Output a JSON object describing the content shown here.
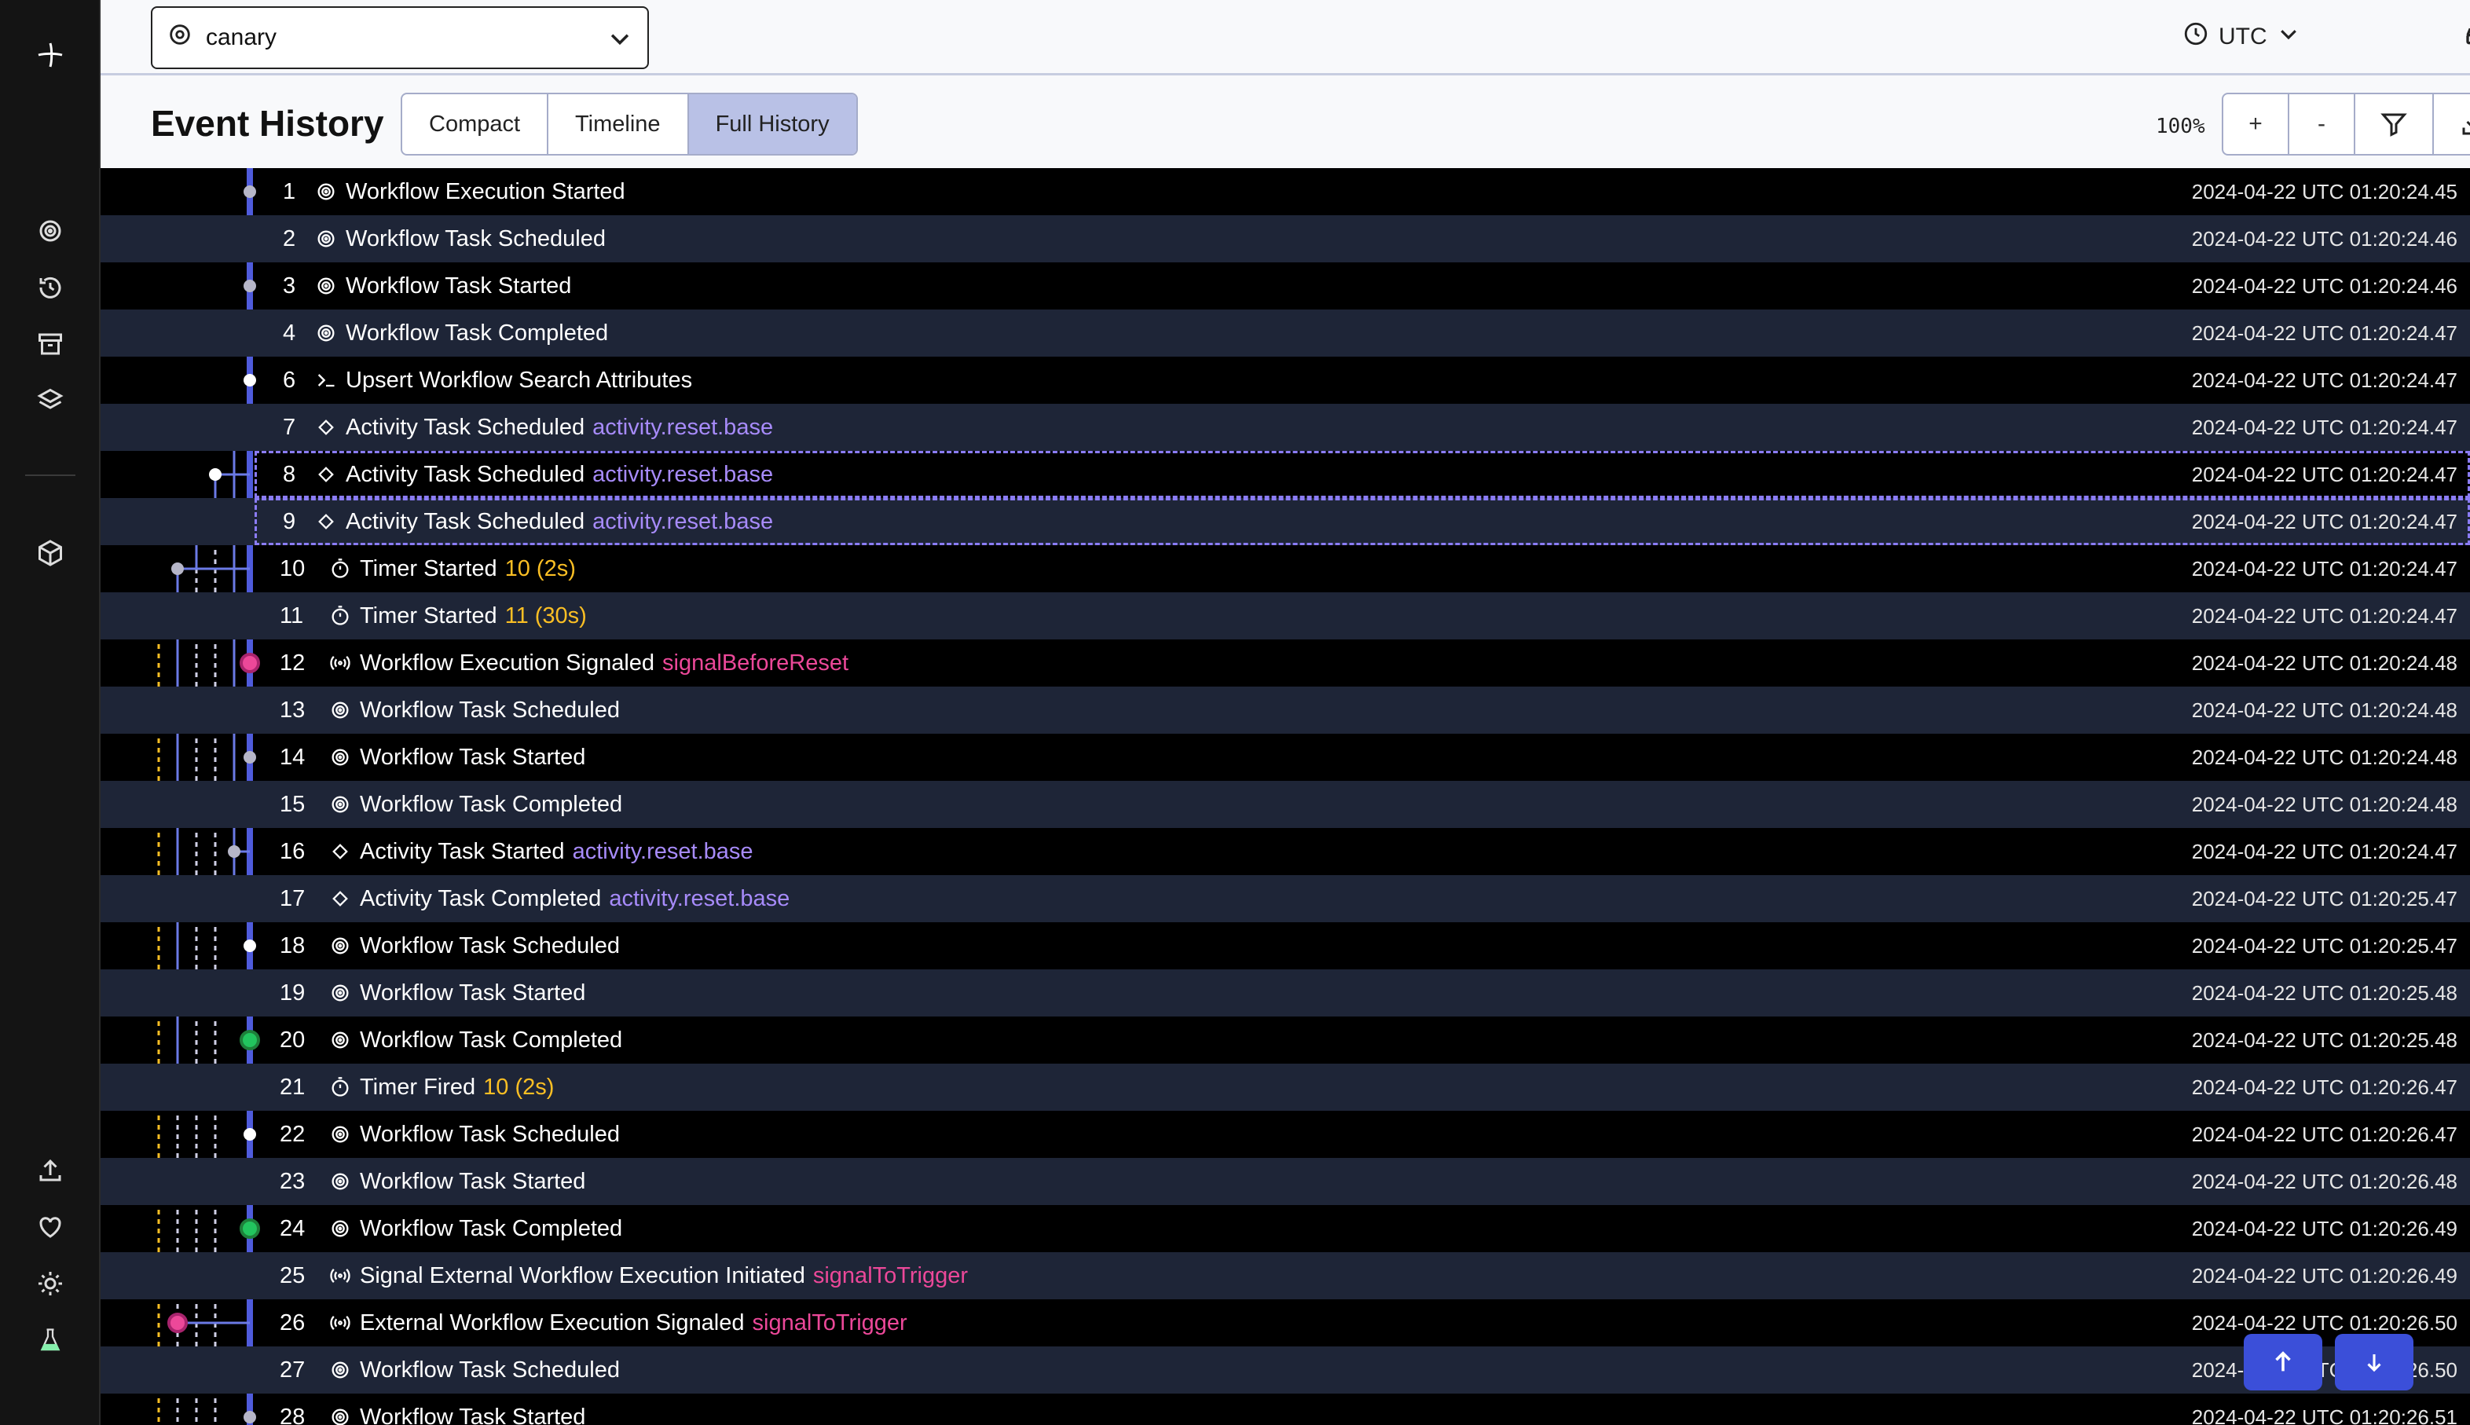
{
  "app": {
    "namespace": "canary",
    "timezone": "UTC"
  },
  "header": {
    "title": "Event History",
    "tabs": [
      {
        "label": "Compact"
      },
      {
        "label": "Timeline"
      },
      {
        "label": "Full History"
      }
    ],
    "zoom": "100%",
    "zoom_in": "+",
    "zoom_out": "-"
  },
  "events": [
    {
      "n": "1",
      "name": "Workflow Execution Started",
      "tag": "",
      "ts": "2024-04-22 UTC 01:20:24.45"
    },
    {
      "n": "2",
      "name": "Workflow Task Scheduled",
      "tag": "",
      "ts": "2024-04-22 UTC 01:20:24.46"
    },
    {
      "n": "3",
      "name": "Workflow Task Started",
      "tag": "",
      "ts": "2024-04-22 UTC 01:20:24.46"
    },
    {
      "n": "4",
      "name": "Workflow Task Completed",
      "tag": "",
      "ts": "2024-04-22 UTC 01:20:24.47"
    },
    {
      "n": "6",
      "name": "Upsert Workflow Search Attributes",
      "tag": "",
      "ts": "2024-04-22 UTC 01:20:24.47"
    },
    {
      "n": "7",
      "name": "Activity Task Scheduled",
      "tag": "activity.reset.base",
      "ts": "2024-04-22 UTC 01:20:24.47"
    },
    {
      "n": "8",
      "name": "Activity Task Scheduled",
      "tag": "activity.reset.base",
      "ts": "2024-04-22 UTC 01:20:24.47"
    },
    {
      "n": "9",
      "name": "Activity Task Scheduled",
      "tag": "activity.reset.base",
      "ts": "2024-04-22 UTC 01:20:24.47"
    },
    {
      "n": "10",
      "name": "Timer Started",
      "tag": "10 (2s)",
      "ts": "2024-04-22 UTC 01:20:24.47"
    },
    {
      "n": "11",
      "name": "Timer Started",
      "tag": "11 (30s)",
      "ts": "2024-04-22 UTC 01:20:24.47"
    },
    {
      "n": "12",
      "name": "Workflow Execution Signaled",
      "tag": "signalBeforeReset",
      "ts": "2024-04-22 UTC 01:20:24.48"
    },
    {
      "n": "13",
      "name": "Workflow Task Scheduled",
      "tag": "",
      "ts": "2024-04-22 UTC 01:20:24.48"
    },
    {
      "n": "14",
      "name": "Workflow Task Started",
      "tag": "",
      "ts": "2024-04-22 UTC 01:20:24.48"
    },
    {
      "n": "15",
      "name": "Workflow Task Completed",
      "tag": "",
      "ts": "2024-04-22 UTC 01:20:24.48"
    },
    {
      "n": "16",
      "name": "Activity Task Started",
      "tag": "activity.reset.base",
      "ts": "2024-04-22 UTC 01:20:24.47"
    },
    {
      "n": "17",
      "name": "Activity Task Completed",
      "tag": "activity.reset.base",
      "ts": "2024-04-22 UTC 01:20:25.47"
    },
    {
      "n": "18",
      "name": "Workflow Task Scheduled",
      "tag": "",
      "ts": "2024-04-22 UTC 01:20:25.47"
    },
    {
      "n": "19",
      "name": "Workflow Task Started",
      "tag": "",
      "ts": "2024-04-22 UTC 01:20:25.48"
    },
    {
      "n": "20",
      "name": "Workflow Task Completed",
      "tag": "",
      "ts": "2024-04-22 UTC 01:20:25.48"
    },
    {
      "n": "21",
      "name": "Timer Fired",
      "tag": "10 (2s)",
      "ts": "2024-04-22 UTC 01:20:26.47"
    },
    {
      "n": "22",
      "name": "Workflow Task Scheduled",
      "tag": "",
      "ts": "2024-04-22 UTC 01:20:26.47"
    },
    {
      "n": "23",
      "name": "Workflow Task Started",
      "tag": "",
      "ts": "2024-04-22 UTC 01:20:26.48"
    },
    {
      "n": "24",
      "name": "Workflow Task Completed",
      "tag": "",
      "ts": "2024-04-22 UTC 01:20:26.49"
    },
    {
      "n": "25",
      "name": "Signal External Workflow Execution Initiated",
      "tag": "signalToTrigger",
      "ts": "2024-04-22 UTC 01:20:26.49"
    },
    {
      "n": "26",
      "name": "External Workflow Execution Signaled",
      "tag": "signalToTrigger",
      "ts": "2024-04-22 UTC 01:20:26.50"
    },
    {
      "n": "27",
      "name": "Workflow Task Scheduled",
      "tag": "",
      "ts": "2024-04-22 UTC 01:20:26.50"
    },
    {
      "n": "28",
      "name": "Workflow Task Started",
      "tag": "",
      "ts": "2024-04-22 UTC 01:20:26.51"
    }
  ],
  "colors": {
    "accent": "#3b4fd9",
    "activity": "#a78bfa",
    "timer": "#fbbf24",
    "signal": "#ec4899",
    "completed": "#22c55e"
  }
}
